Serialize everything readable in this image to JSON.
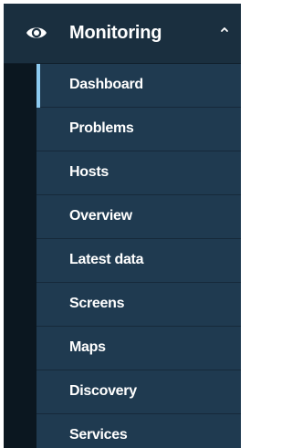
{
  "menu": {
    "section_title": "Monitoring",
    "section_icon": "eye-icon",
    "expanded_icon": "chevron-up-icon",
    "items": [
      {
        "label": "Dashboard"
      },
      {
        "label": "Problems"
      },
      {
        "label": "Hosts"
      },
      {
        "label": "Overview"
      },
      {
        "label": "Latest data"
      },
      {
        "label": "Screens"
      },
      {
        "label": "Maps"
      },
      {
        "label": "Discovery"
      },
      {
        "label": "Services"
      }
    ],
    "active_item": "Dashboard"
  },
  "colors": {
    "panel_bg": "#1f3a50",
    "header_bg": "#1a2f3f",
    "gutter_bg": "#0b1720",
    "active_indicator": "#8ccaf0",
    "text": "#ffffff"
  }
}
